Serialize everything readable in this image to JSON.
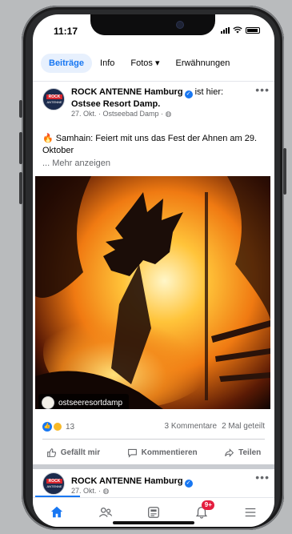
{
  "status_bar": {
    "time": "11:17"
  },
  "tabs": [
    {
      "label": "Beiträge",
      "active": true
    },
    {
      "label": "Info",
      "active": false
    },
    {
      "label": "Fotos ▾",
      "active": false
    },
    {
      "label": "Erwähnungen",
      "active": false
    }
  ],
  "post": {
    "page_name": "ROCK ANTENNE Hamburg",
    "checkin_text": "ist hier:",
    "location": "Ostsee Resort Damp.",
    "meta": "27. Okt. · Ostseebad Damp · ",
    "text": "Samhain: Feiert mit uns das Fest der Ahnen am 29. Oktober",
    "more_label": "... Mehr anzeigen",
    "photo_tag": "ostseeresortdamp",
    "reaction_count": "13",
    "comments": "3 Kommentare",
    "shares": "2 Mal geteilt",
    "actions": {
      "like": "Gefällt mir",
      "comment": "Kommentieren",
      "share": "Teilen"
    }
  },
  "post2": {
    "page_name": "ROCK ANTENNE Hamburg",
    "meta": "27. Okt. · "
  },
  "avatar_logo": {
    "line1": "ROCK",
    "line2": "ANTENNE"
  },
  "bottom_nav": {
    "notifications_badge": "9+"
  },
  "colors": {
    "accent": "#1877f2",
    "badge": "#e41e3f",
    "text_secondary": "#65676b"
  }
}
